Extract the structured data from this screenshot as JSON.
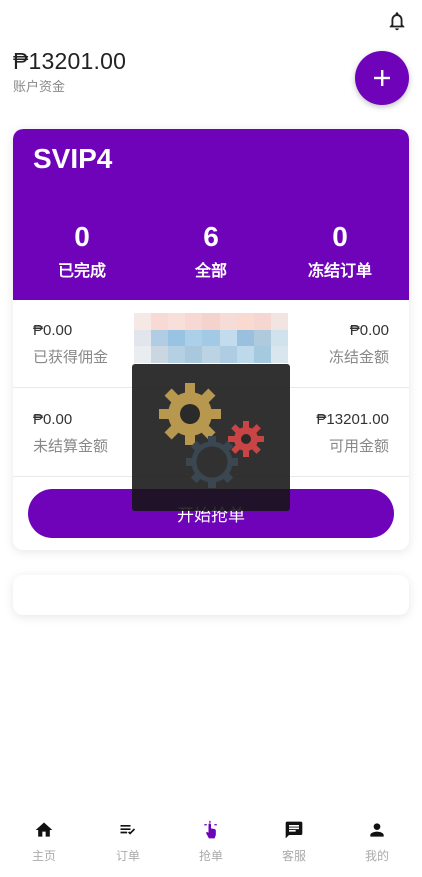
{
  "header": {
    "balance": "₱13201.00",
    "balance_label": "账户资金"
  },
  "card": {
    "level": "SVIP4",
    "stats": [
      {
        "value": "0",
        "label": "已完成"
      },
      {
        "value": "6",
        "label": "全部"
      },
      {
        "value": "0",
        "label": "冻结订单"
      }
    ],
    "rows": [
      {
        "left_value": "₱0.00",
        "left_label": "已获得佣金",
        "right_value": "₱0.00",
        "right_label": "冻结金额"
      },
      {
        "left_value": "₱0.00",
        "left_label": "未结算金额",
        "right_value": "₱13201.00",
        "right_label": "可用金额"
      }
    ],
    "button_label": "开始抢单"
  },
  "nav": [
    {
      "label": "主页",
      "icon": "home-icon"
    },
    {
      "label": "订单",
      "icon": "order-list-icon"
    },
    {
      "label": "抢单",
      "icon": "grab-order-icon"
    },
    {
      "label": "客服",
      "icon": "chat-icon"
    },
    {
      "label": "我的",
      "icon": "person-icon"
    }
  ],
  "colors": {
    "primary": "#6e03b9",
    "background": "#ffffff"
  }
}
